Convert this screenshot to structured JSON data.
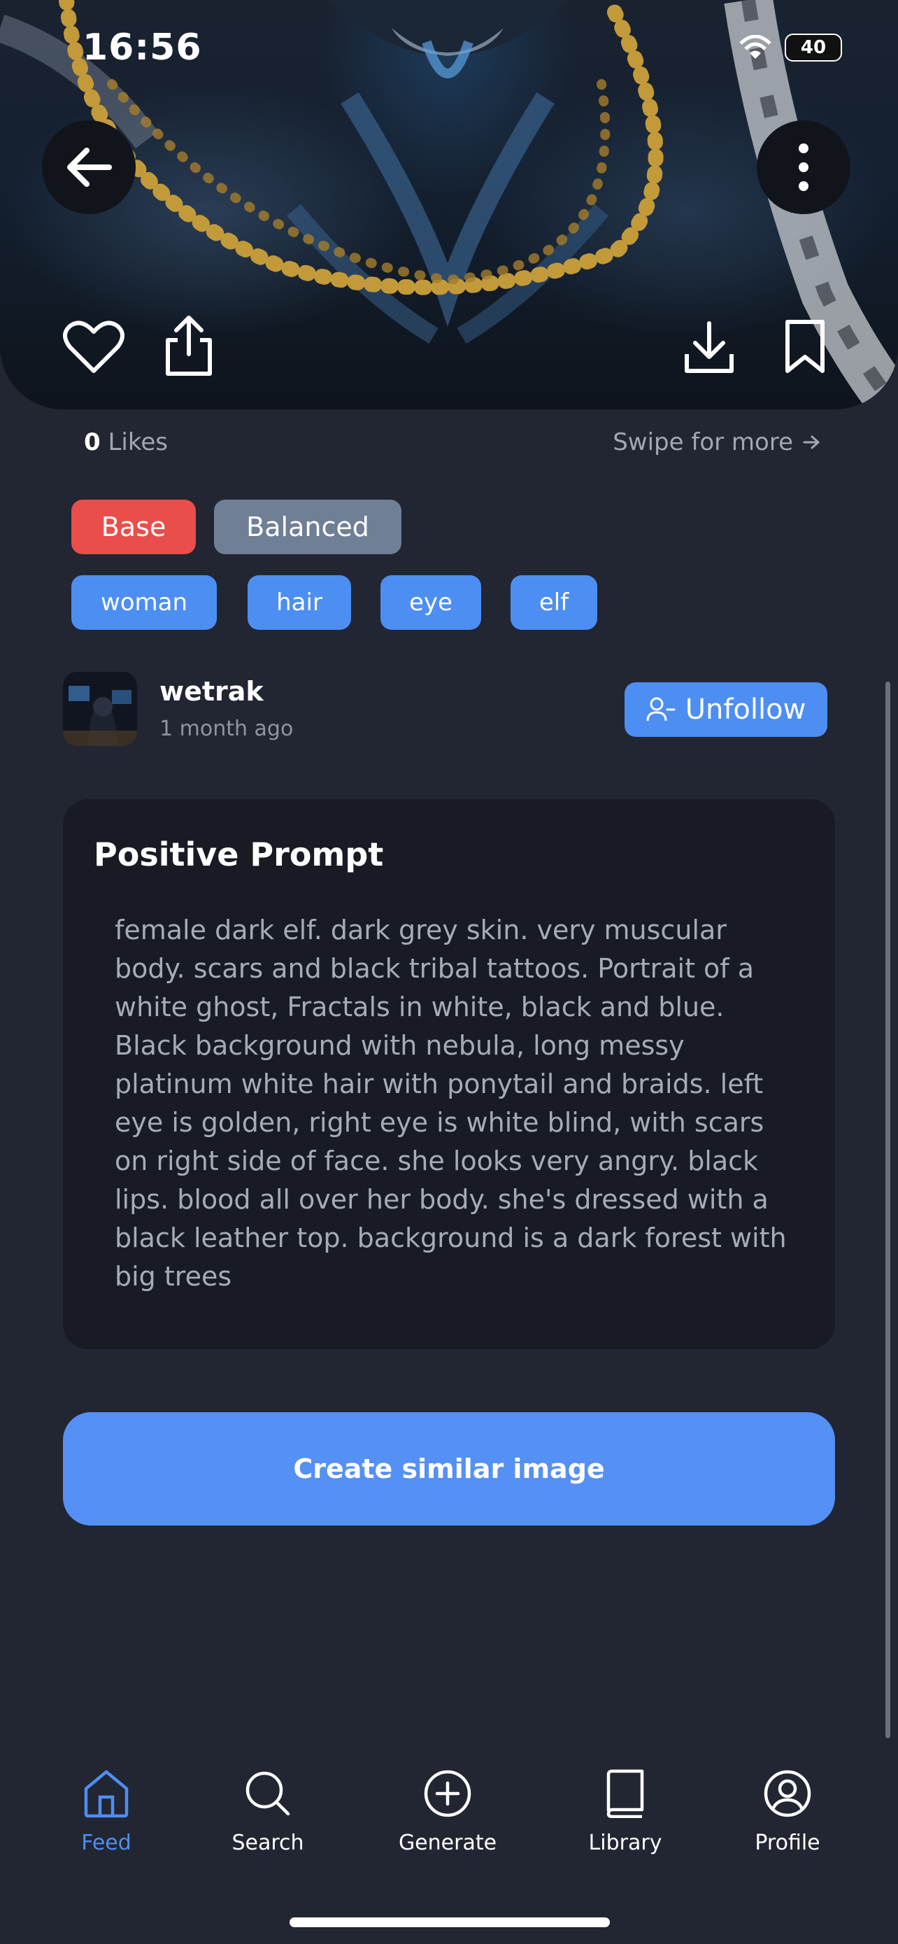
{
  "status_bar": {
    "time": "16:56",
    "battery": "40"
  },
  "post": {
    "likes_count": "0",
    "likes_label": "Likes",
    "swipe_hint": "Swipe for more",
    "model_chips": [
      "Base",
      "Balanced"
    ],
    "tags": [
      "woman",
      "hair",
      "eye",
      "elf"
    ]
  },
  "author": {
    "name": "wetrak",
    "time_ago": "1 month ago",
    "follow_button": "Unfollow"
  },
  "prompt": {
    "title": "Positive Prompt",
    "text": "female dark elf. dark grey skin. very muscular body. scars and black tribal tattoos. Portrait of a white ghost, Fractals in white, black and blue. Black background with nebula, long messy platinum white hair with ponytail and braids. left eye is golden, right eye is white blind, with scars on right side of face. she looks very angry. black lips. blood all over her body. she's dressed with a black leather top. background is a dark forest with big trees"
  },
  "create_button": "Create similar image",
  "tab_bar": {
    "items": [
      {
        "label": "Feed",
        "icon": "home-icon",
        "active": true
      },
      {
        "label": "Search",
        "icon": "search-icon",
        "active": false
      },
      {
        "label": "Generate",
        "icon": "plus-circle-icon",
        "active": false
      },
      {
        "label": "Library",
        "icon": "book-icon",
        "active": false
      },
      {
        "label": "Profile",
        "icon": "user-icon",
        "active": false
      }
    ]
  },
  "colors": {
    "background": "#222532",
    "accent": "#4d8ef2",
    "base_chip": "#e94e4b",
    "balanced_chip": "#6f7f96",
    "card": "#181b24"
  }
}
